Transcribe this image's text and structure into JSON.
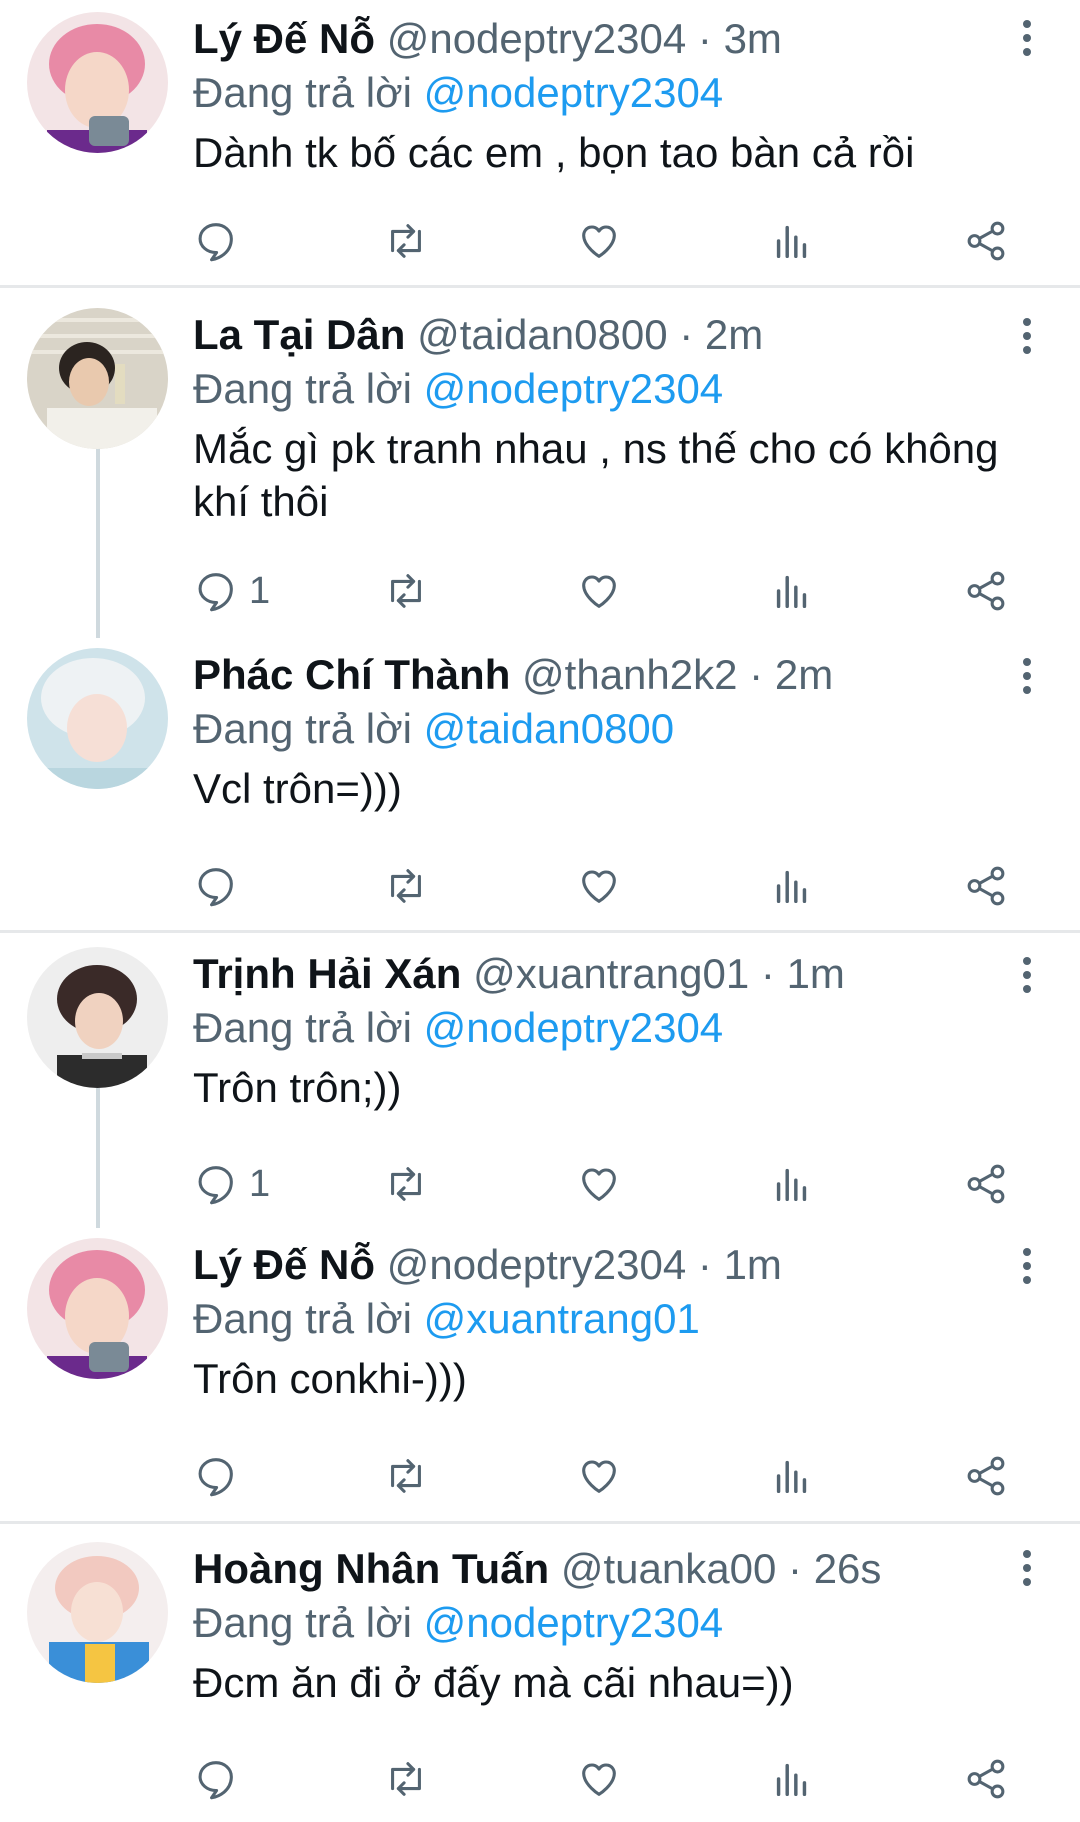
{
  "tweets": [
    {
      "name": "Lý Đế Nỗ",
      "handle": "@nodeptry2304",
      "time": "3m",
      "reply_prefix": "Đang trả lời",
      "reply_to": "@nodeptry2304",
      "text": "Dành tk bố các em , bọn tao bàn cả rồi",
      "reply_count": "",
      "avatar": "pink-hair-avatar"
    },
    {
      "name": "La Tại Dân",
      "handle": "@taidan0800",
      "time": "2m",
      "reply_prefix": "Đang trả lời",
      "reply_to": "@nodeptry2304",
      "text": "Mắc gì pk tranh nhau , ns thế cho có không khí thôi",
      "reply_count": "1",
      "avatar": "dark-hair-avatar"
    },
    {
      "name": "Phác Chí Thành",
      "handle": "@thanh2k2",
      "time": "2m",
      "reply_prefix": "Đang trả lời",
      "reply_to": "@taidan0800",
      "text": "Vcl trôn=)))",
      "reply_count": "",
      "avatar": "silver-hair-avatar"
    },
    {
      "name": "Trịnh Hải Xán",
      "handle": "@xuantrang01",
      "time": "1m",
      "reply_prefix": "Đang trả lời",
      "reply_to": "@nodeptry2304",
      "text": "Trôn trôn;))",
      "reply_count": "1",
      "avatar": "black-hair-avatar"
    },
    {
      "name": "Lý Đế Nỗ",
      "handle": "@nodeptry2304",
      "time": "1m",
      "reply_prefix": "Đang trả lời",
      "reply_to": "@xuantrang01",
      "text": "Trôn conkhi-)))",
      "reply_count": "",
      "avatar": "pink-hair-avatar"
    },
    {
      "name": "Hoàng Nhân Tuấn",
      "handle": "@tuanka00",
      "time": "26s",
      "reply_prefix": "Đang trả lời",
      "reply_to": "@nodeptry2304",
      "text": "Đcm ăn đi ở đấy mà cãi nhau=))",
      "reply_count": "",
      "avatar": "blonde-hair-avatar"
    }
  ],
  "separator": "·",
  "colors": {
    "accent": "#1d9bf0",
    "muted": "#536471",
    "text": "#0f1419",
    "divider": "#e6e8ea"
  }
}
